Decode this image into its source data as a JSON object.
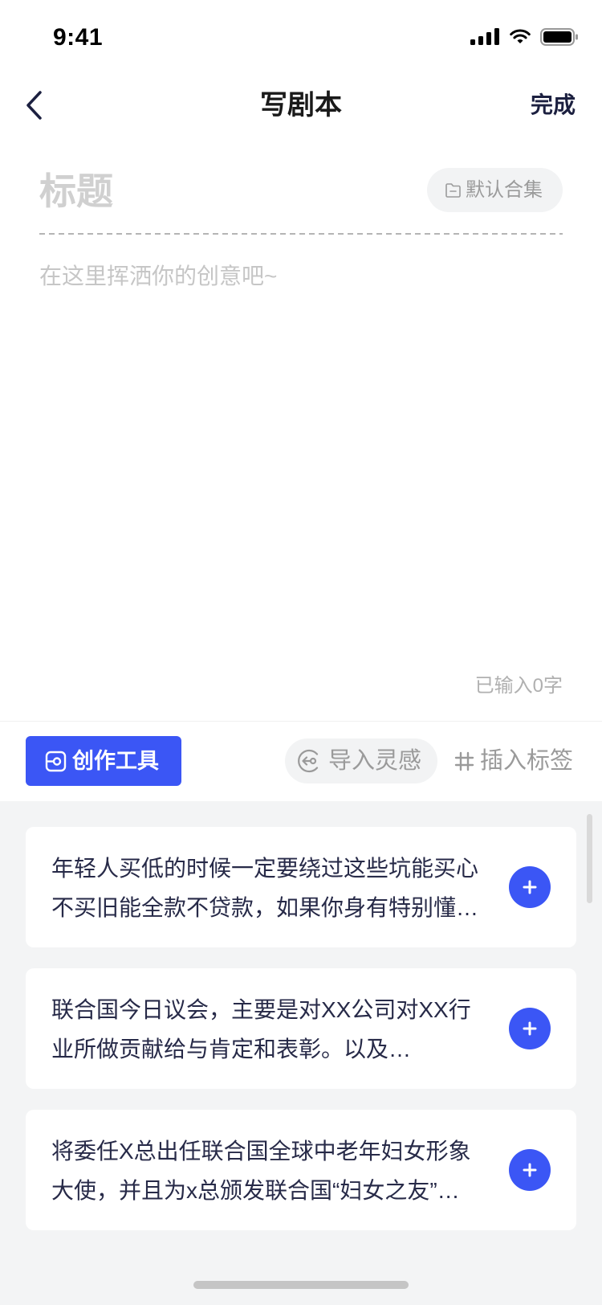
{
  "status_bar": {
    "time": "9:41",
    "icons": [
      "signal-icon",
      "wifi-icon",
      "battery-icon"
    ]
  },
  "nav": {
    "back_icon": "chevron-left-icon",
    "title": "写剧本",
    "done_label": "完成"
  },
  "editor": {
    "title_placeholder": "标题",
    "title_value": "",
    "collection": {
      "icon": "folder-icon",
      "label": "默认合集"
    },
    "content_placeholder": "在这里挥洒你的创意吧~",
    "content_value": "",
    "word_count": "已输入0字"
  },
  "toolbar": {
    "creation_tools": {
      "icon": "tool-icon",
      "label": "创作工具",
      "active": true
    },
    "import_inspiration": {
      "icon": "import-icon",
      "label": "导入灵感"
    },
    "insert_tag": {
      "icon": "hash-icon",
      "label": "插入标签"
    }
  },
  "inspiration_list": [
    {
      "lines": [
        "年轻人买低的时候一定要绕过这些坑能买心",
        "不买旧能全款不贷款，如果你身有特别懂…"
      ],
      "action_icon": "plus-icon"
    },
    {
      "lines": [
        "联合国今日议会，主要是对XX公司对XX行",
        "业所做贡献给与肯定和表彰。以及…"
      ],
      "action_icon": "plus-icon"
    },
    {
      "lines": [
        "将委任X总出任联合国全球中老年妇女形象",
        "大使，并且为x总颁发联合国“妇女之友”…"
      ],
      "action_icon": "plus-icon"
    }
  ],
  "colors": {
    "accent": "#3b56f5",
    "panel_background": "#f3f4f5",
    "text_primary": "#1c2040",
    "placeholder": "#cccccc",
    "secondary_text": "#9b9b9b",
    "card_text": "#272a48"
  }
}
